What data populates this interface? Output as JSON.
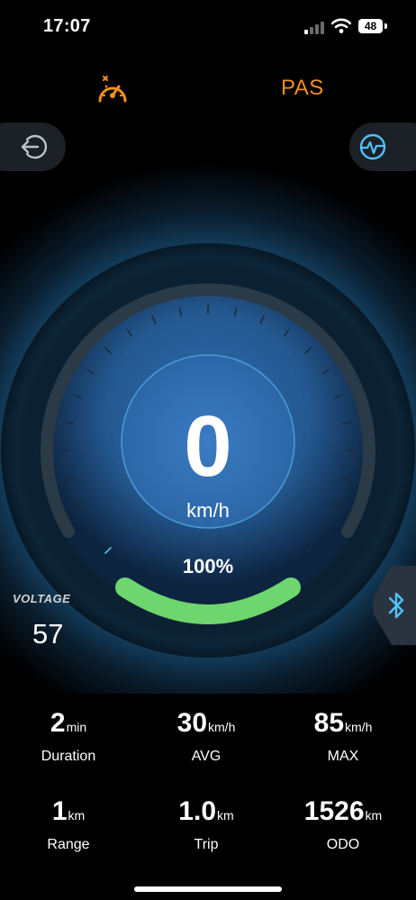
{
  "status_bar": {
    "time": "17:07",
    "battery": "48"
  },
  "header": {
    "mode_label": "PAS",
    "mode_icon": "speedometer-icon"
  },
  "buttons": {
    "left_icon": "back-arrow-icon",
    "right_icon": "heartbeat-icon",
    "bluetooth_icon": "bluetooth-icon"
  },
  "speed": {
    "value": "0",
    "unit": "km/h"
  },
  "battery_level": {
    "label": "100%",
    "fraction": 1.0
  },
  "voltage": {
    "label": "VOLTAGE",
    "value": "57"
  },
  "metrics": [
    {
      "value": "2",
      "unit": "min",
      "label": "Duration"
    },
    {
      "value": "30",
      "unit": "km/h",
      "label": "AVG"
    },
    {
      "value": "85",
      "unit": "km/h",
      "label": "MAX"
    },
    {
      "value": "1",
      "unit": "km",
      "label": "Range"
    },
    {
      "value": "1.0",
      "unit": "km",
      "label": "Trip"
    },
    {
      "value": "1526",
      "unit": "km",
      "label": "ODO"
    }
  ],
  "colors": {
    "accent_orange": "#f0901f",
    "battery_green": "#6ed56f",
    "dial_blue": "#2b66a6",
    "icon_blue": "#4fc3f7"
  }
}
